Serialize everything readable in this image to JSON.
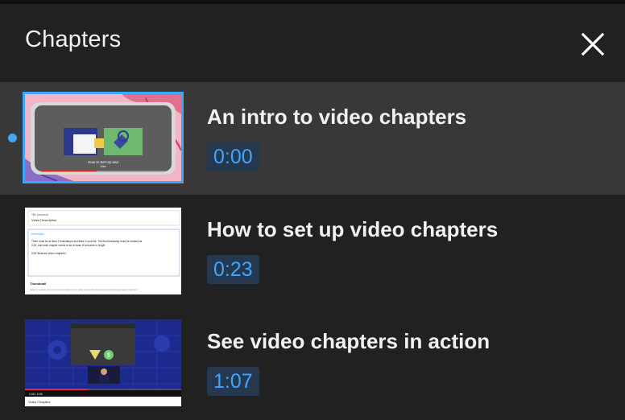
{
  "header": {
    "title": "Chapters",
    "close_icon": "close-icon"
  },
  "accent_color": "#3ea6ff",
  "chapters": [
    {
      "title": "An intro to video chapters",
      "time": "0:00",
      "active": true,
      "thumbnail": {
        "title": "How to Set Up and",
        "subtitle": "Use",
        "progress": 0.45
      }
    },
    {
      "title": "How to set up video chapters",
      "time": "0:23",
      "active": false,
      "thumbnail": {
        "header": "Video Description",
        "field_label": "Description",
        "line1": "There must be at least 3 timestamps and titles in your list. The first timestamp must be marked as",
        "line2": "0:00, and each chapter needs to be at least 10 seconds in length.",
        "line3": "0:00 What are video chapters?",
        "thumb_label": "Thumbnail",
        "thumb_hint": "Select or upload a picture that shows what's in your video. A good thumbnail stands out and draws viewers' attention."
      }
    },
    {
      "title": "See video chapters in action",
      "time": "1:07",
      "active": false,
      "thumbnail": {
        "caption": "Video Chapters",
        "player_time": "1:00 / 2:05",
        "progress": 0.4
      }
    }
  ]
}
